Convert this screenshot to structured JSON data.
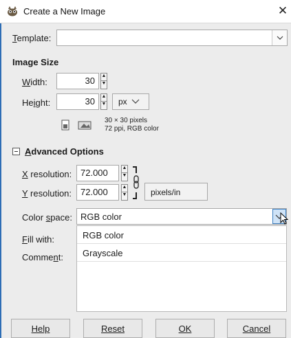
{
  "window": {
    "title": "Create a New Image"
  },
  "template": {
    "label": "Template:",
    "value": ""
  },
  "image_size": {
    "heading": "Image Size",
    "width_label": "Width:",
    "width_value": "30",
    "height_label": "Height:",
    "height_value": "30",
    "unit": "px",
    "info_line1": "30 × 30 pixels",
    "info_line2": "72 ppi, RGB color"
  },
  "advanced": {
    "heading": "Advanced Options",
    "x_res_label": "X resolution:",
    "x_res_value": "72.000",
    "y_res_label": "Y resolution:",
    "y_res_value": "72.000",
    "res_unit": "pixels/in",
    "color_space_label": "Color space:",
    "color_space_value": "RGB color",
    "color_space_options": [
      "RGB color",
      "Grayscale"
    ],
    "fill_label": "Fill with:",
    "comment_label": "Comment:"
  },
  "buttons": {
    "help": "Help",
    "reset": "Reset",
    "ok": "OK",
    "cancel": "Cancel"
  },
  "colors": {
    "accent": "#2d6db5",
    "background": "#ececec"
  }
}
